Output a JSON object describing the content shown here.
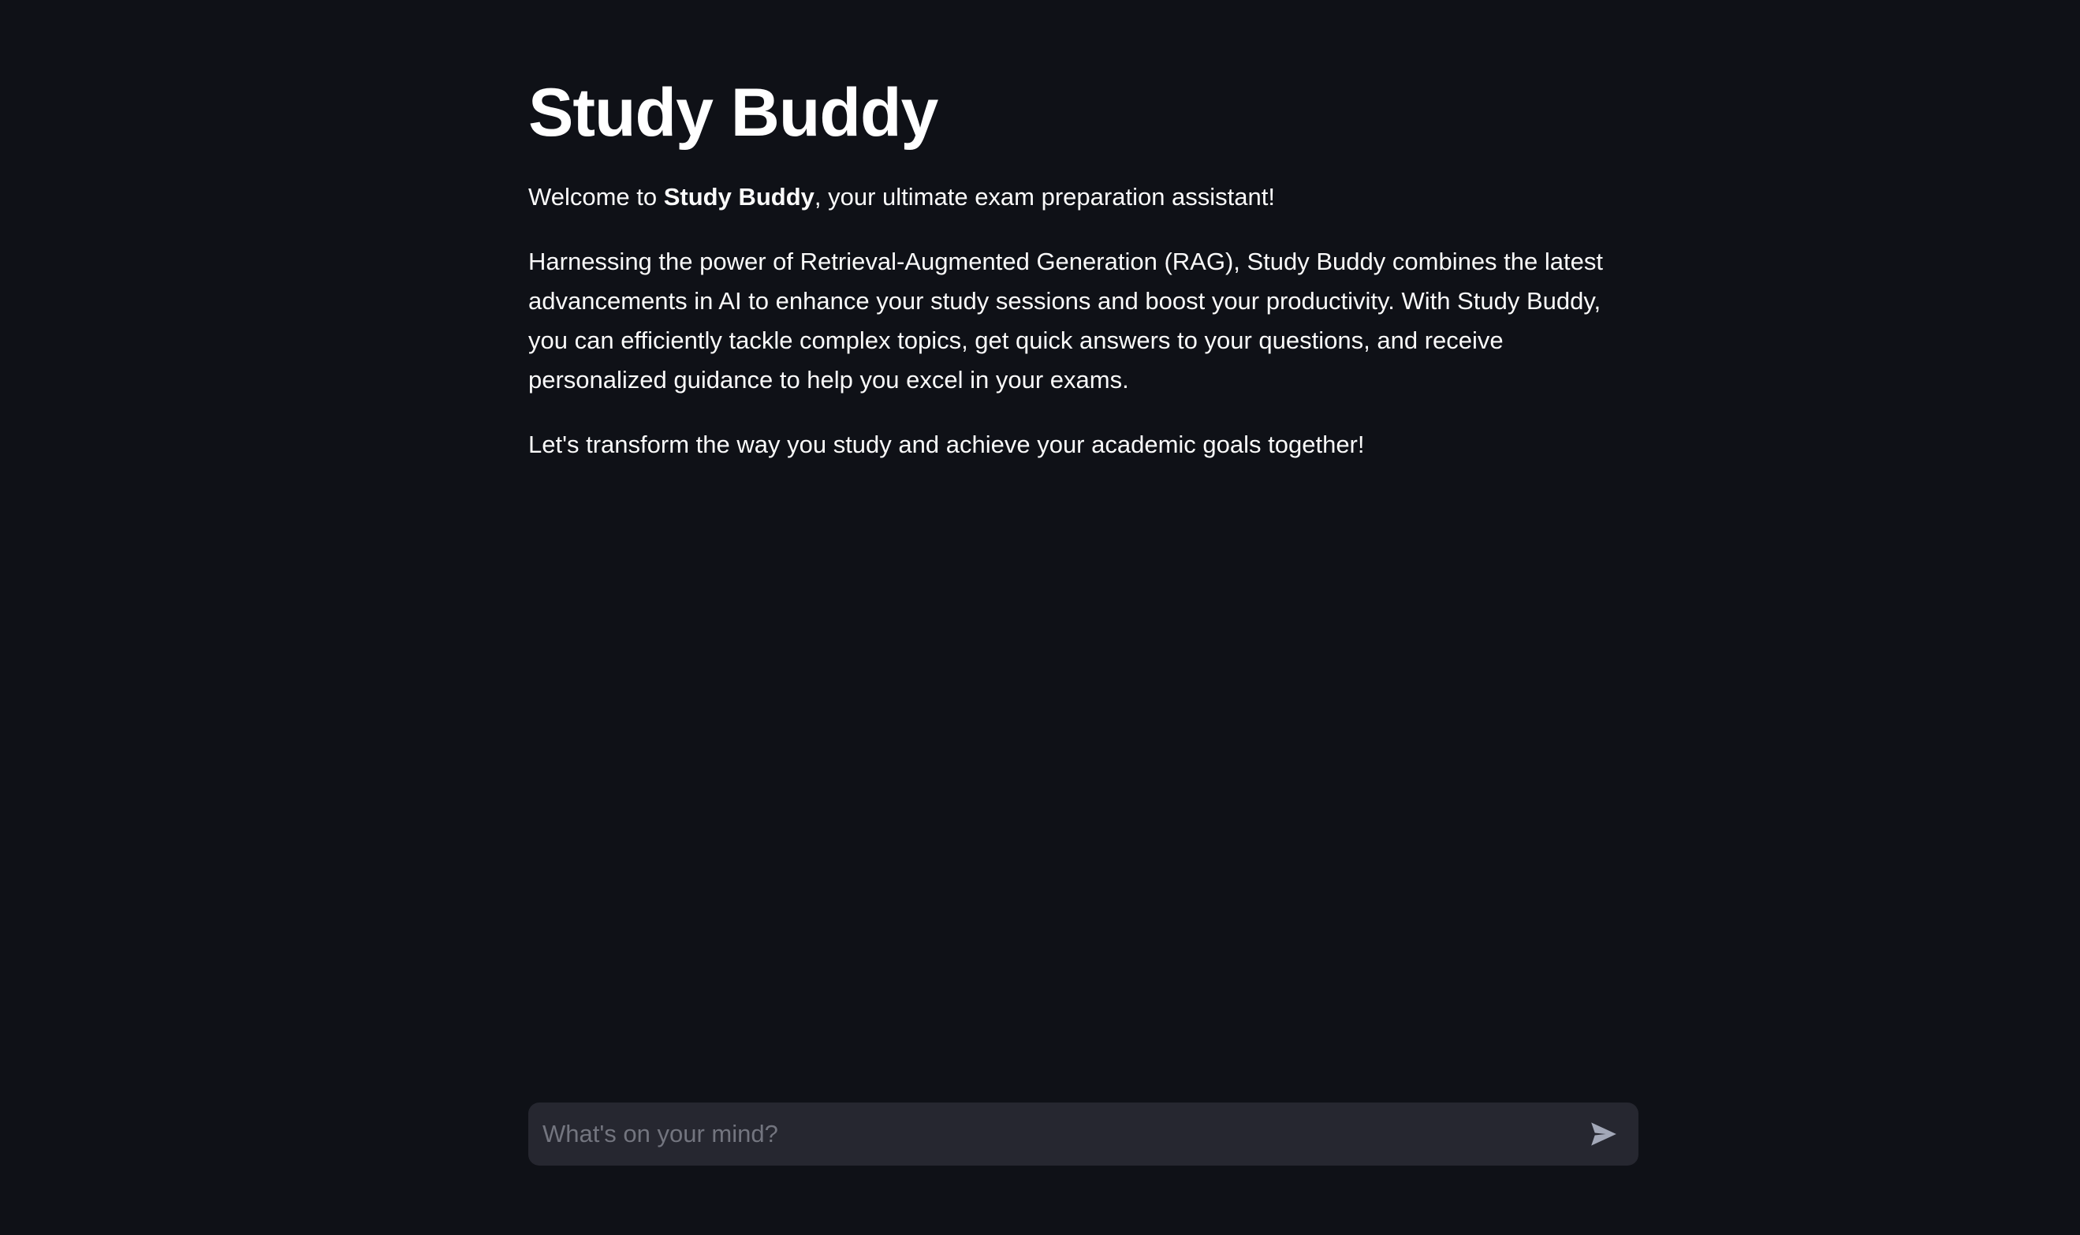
{
  "app": {
    "title": "Study Buddy"
  },
  "intro": {
    "welcome_prefix": "Welcome to ",
    "welcome_bold": "Study Buddy",
    "welcome_suffix": ", your ultimate exam preparation assistant!",
    "description": "Harnessing the power of Retrieval-Augmented Generation (RAG), Study Buddy combines the latest advancements in AI to enhance your study sessions and boost your productivity. With Study Buddy, you can efficiently tackle complex topics, get quick answers to your questions, and receive personalized guidance to help you excel in your exams.",
    "closing": "Let's transform the way you study and achieve your academic goals together!"
  },
  "chat": {
    "value": "",
    "placeholder": "What's on your mind?",
    "send_icon": "send-icon"
  },
  "colors": {
    "background": "#0f1117",
    "text": "#fafafa",
    "input_background": "#262730",
    "placeholder": "#73757f",
    "send_icon": "#a3a8b8"
  }
}
